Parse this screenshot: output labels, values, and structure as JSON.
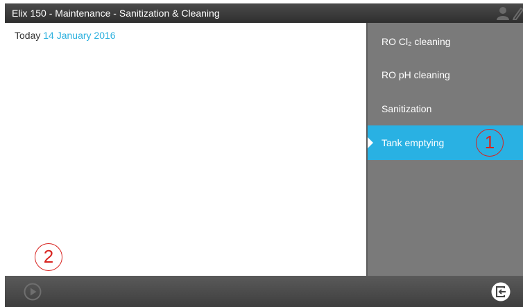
{
  "titlebar": {
    "title": "Elix 150 - Maintenance - Sanitization & Cleaning",
    "icons": [
      "user-icon",
      "pen-icon"
    ]
  },
  "main": {
    "today_label": "Today",
    "today_date": "14 January 2016",
    "date_color": "#2bb0de"
  },
  "sidebar": {
    "items": [
      {
        "label": "RO Cl₂ cleaning",
        "active": false
      },
      {
        "label": "RO pH cleaning",
        "active": false
      },
      {
        "label": "Sanitization",
        "active": false
      },
      {
        "label": "Tank emptying",
        "active": true
      }
    ],
    "active_color": "#29b1e3"
  },
  "callouts": {
    "one": "1",
    "two": "2",
    "color": "#d8231f"
  },
  "bottombar": {
    "icons": [
      "play-icon",
      "exit-icon"
    ]
  }
}
